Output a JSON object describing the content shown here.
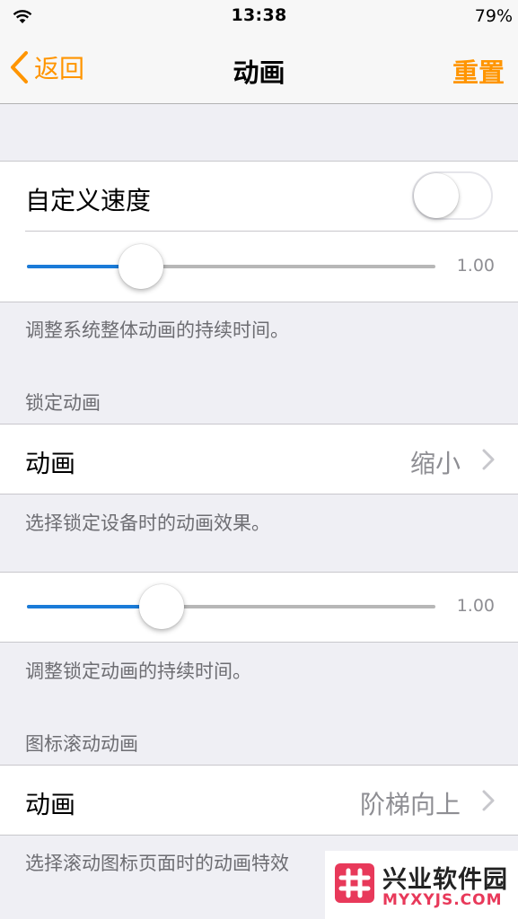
{
  "status_bar": {
    "time": "13:38",
    "battery": "79%"
  },
  "nav": {
    "back_label": "返回",
    "title": "动画",
    "reset_label": "重置"
  },
  "custom_speed": {
    "label": "自定义速度",
    "toggle_on": false,
    "slider_fraction": 0.28,
    "slider_value": "1.00",
    "footer": "调整系统整体动画的持续时间。"
  },
  "lock_animation": {
    "header": "锁定动画",
    "row_label": "动画",
    "row_value": "缩小",
    "footer": "选择锁定设备时的动画效果。",
    "slider_fraction": 0.33,
    "slider_value": "1.00",
    "slider_footer": "调整锁定动画的持续时间。"
  },
  "icon_scroll": {
    "header": "图标滚动动画",
    "row_label": "动画",
    "row_value": "阶梯向上",
    "footer": "选择滚动图标页面时的动画特效"
  },
  "watermark": {
    "title": "兴业软件园",
    "subtitle": "MYXYJS.COM"
  },
  "colors": {
    "accent": "#ff9500",
    "slider_fill": "#1a7bd8",
    "background": "#efeff4",
    "secondary_text": "#8e8e93",
    "watermark_brand": "#e8395a"
  },
  "icons": [
    "wifi-icon",
    "back-chevron-icon",
    "chevron-right-icon",
    "watermark-logo-icon"
  ]
}
